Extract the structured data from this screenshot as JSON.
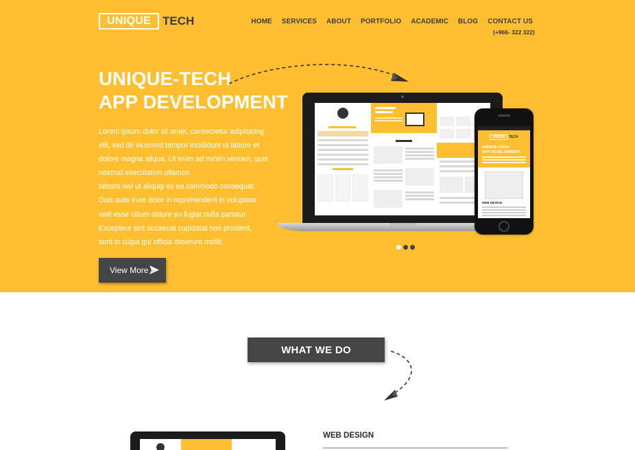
{
  "logo": {
    "boxed": "UNIQUE",
    "rest": "TECH"
  },
  "nav": {
    "items": [
      "HOME",
      "SERVICES",
      "ABOUT",
      "PORTFOLIO",
      "ACADEMIC",
      "BLOG",
      "CONTACT US"
    ],
    "phone": "(+966- 322 322)"
  },
  "hero": {
    "title_line1": "UNIQUE-TECH",
    "title_line2": "APP DEVELOPMENT",
    "text_lines": [
      "Lorem ipsum dolor sit amet, consectetur adipisicing",
      "elit, sed do eiusmod tempor incididunt ut labore et",
      "dolore magna aliqua. Ut enim ad minim veniam, quis",
      "nostrud exercitation ullamco.",
      "laboris nisi ut aliquip ex ea commodo consequat.",
      "Duis aute irure dolor in reprehenderit in voluptate",
      "velit esse cillum dolore eu fugiat nulla pariatur.",
      "Excepteur sint occaecat cupidatat non proident,",
      "sunt in culpa qui officia deserunt mollit."
    ],
    "button_label": "View More"
  },
  "slider": {
    "count": 3,
    "active": 0
  },
  "section": {
    "heading": "WHAT WE DO",
    "service_title": "WEB DESIGN"
  },
  "colors": {
    "brand_yellow": "#FFBF30",
    "dark_button": "#454545",
    "white": "#FFFFFF"
  },
  "icons": [
    "paper-plane-icon",
    "dashed-arrow-icon"
  ]
}
